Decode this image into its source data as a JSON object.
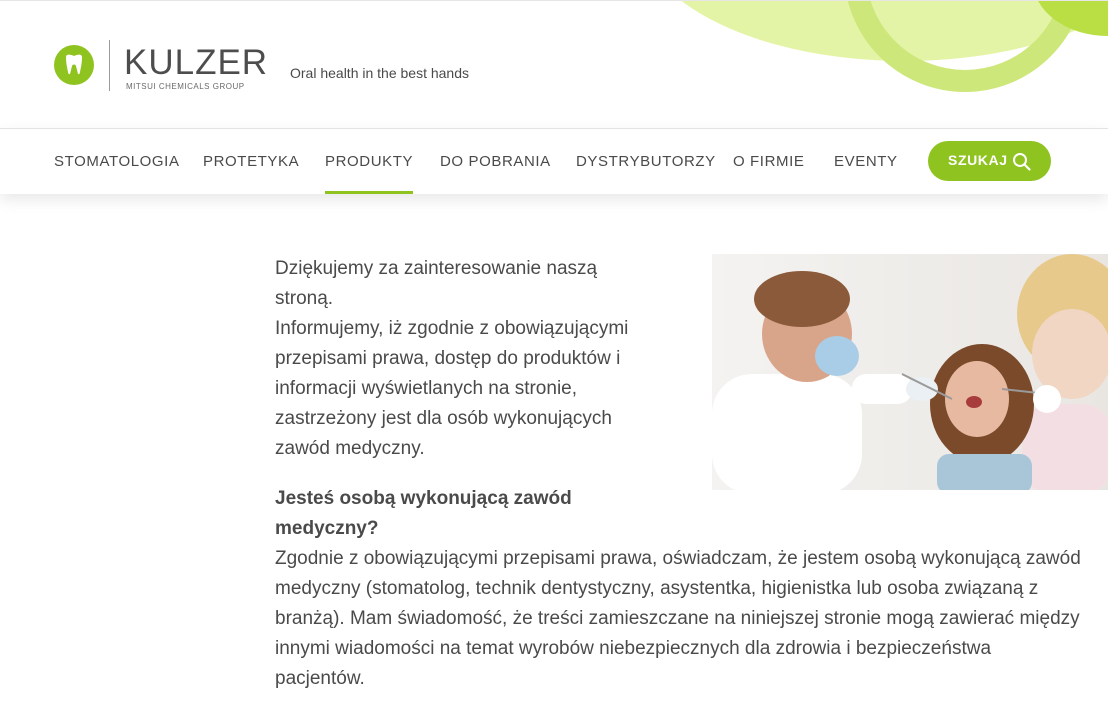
{
  "brand": {
    "name": "KULZER",
    "subtitle": "MITSUI CHEMICALS GROUP",
    "tagline": "Oral health in the best hands",
    "accent_color": "#8fc31f",
    "logo_icon": "tooth-icon"
  },
  "nav": {
    "items": [
      {
        "label": "STOMATOLOGIA",
        "active": false
      },
      {
        "label": "PROTETYKA",
        "active": false
      },
      {
        "label": "PRODUKTY",
        "active": true
      },
      {
        "label": "DO POBRANIA",
        "active": false
      },
      {
        "label": "DYSTRYBUTORZY",
        "active": false
      },
      {
        "label": "O FIRMIE",
        "active": false
      },
      {
        "label": "EVENTY",
        "active": false
      }
    ],
    "search_label": "SZUKAJ",
    "search_icon": "search-icon"
  },
  "main": {
    "intro_lines": [
      "Dziękujemy za zainteresowanie naszą",
      "stroną.",
      "Informujemy, iż zgodnie z obowiązującymi",
      "przepisami prawa, dostęp do produktów i",
      "informacji wyświetlanych na stronie,",
      "zastrzeżony jest dla osób wykonujących",
      "zawód medyczny."
    ],
    "question_lines": [
      "Jesteś osobą wykonującą zawód",
      "medyczny?"
    ],
    "declaration_lines": [
      "Zgodnie z obowiązującymi przepisami prawa, oświadczam, że jestem osobą wykonującą zawód",
      "medyczny (stomatolog, technik dentystyczny, asystentka, higienistka lub osoba związaną z",
      "branżą). Mam świadomość, że treści zamieszczane na niniejszej stronie mogą zawierać między",
      "innymi wiadomości na temat wyrobów niebezpiecznych dla zdrowia i bezpieczeństwa",
      "pacjentów."
    ]
  }
}
